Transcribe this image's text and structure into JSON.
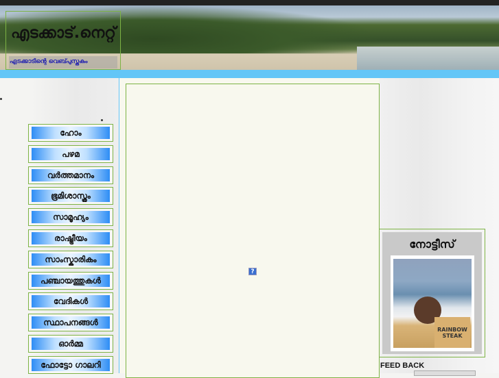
{
  "header": {
    "title": "എടക്കാട്.നെറ്റ്",
    "subtitle": "എടക്കാടിന്റെ  വെബ്പുസ്തകം"
  },
  "menu": [
    "ഹോം",
    "പഴമ",
    "വർത്തമാനം",
    "ഭൂമിശാസ്ത്രം",
    "സാമൂഹ്യം",
    "രാഷ്ട്രീയം",
    "സാംസ്കാരികം",
    "പഞ്ചായത്തുകൾ",
    "വേദികൾ",
    "സ്ഥാപനങ്ങൾ",
    "ഓർമ്മ",
    "ഫോട്ടോ ഗാലറി"
  ],
  "content": {
    "missing_plugin_icon": "?"
  },
  "notice": {
    "title": "നോട്ടീസ്",
    "podium_text": "RAINBOW STEAK"
  },
  "feedback": {
    "label": "FEED BACK"
  }
}
